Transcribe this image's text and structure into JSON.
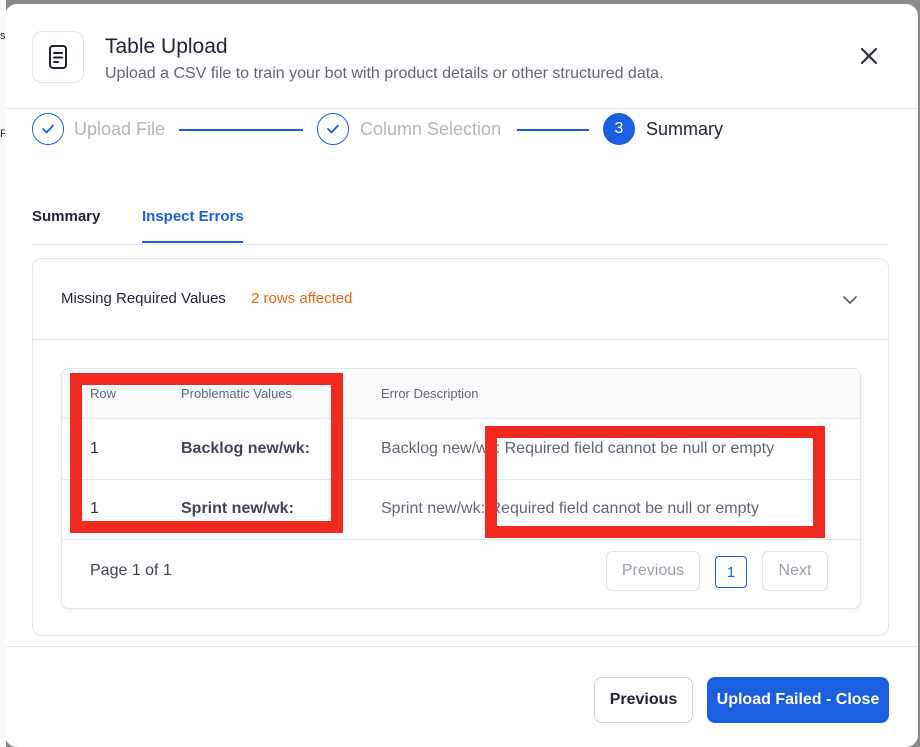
{
  "background": {
    "glyphs": [
      "s",
      "F"
    ]
  },
  "header": {
    "title": "Table Upload",
    "subtitle": "Upload a CSV file to train your bot with product details or other structured data.",
    "icon": "document-icon",
    "close_icon": "close-icon"
  },
  "stepper": {
    "steps": [
      {
        "label": "Upload File",
        "status": "completed"
      },
      {
        "label": "Column Selection",
        "status": "completed"
      },
      {
        "label": "Summary",
        "status": "active",
        "number": "3"
      }
    ]
  },
  "tabs": {
    "items": [
      {
        "label": "Summary",
        "active": false
      },
      {
        "label": "Inspect Errors",
        "active": true
      }
    ]
  },
  "error_group": {
    "title": "Missing Required Values",
    "count": "2 rows affected",
    "expanded": true,
    "table": {
      "columns": [
        "Row",
        "Problematic Values",
        "Error Description"
      ],
      "rows": [
        {
          "row": "1",
          "value": "Backlog new/wk:",
          "description": "Backlog new/wk: Required field cannot be null or empty"
        },
        {
          "row": "1",
          "value": "Sprint new/wk:",
          "description": "Sprint new/wk: Required field cannot be null or empty"
        }
      ]
    },
    "pagination": {
      "info": "Page 1 of 1",
      "previous_label": "Previous",
      "current_page": "1",
      "next_label": "Next"
    }
  },
  "footer": {
    "previous_label": "Previous",
    "primary_label": "Upload Failed - Close"
  },
  "colors": {
    "accent": "#1a5fe0",
    "warning": "#e8671d",
    "annotation": "#f12a20"
  }
}
